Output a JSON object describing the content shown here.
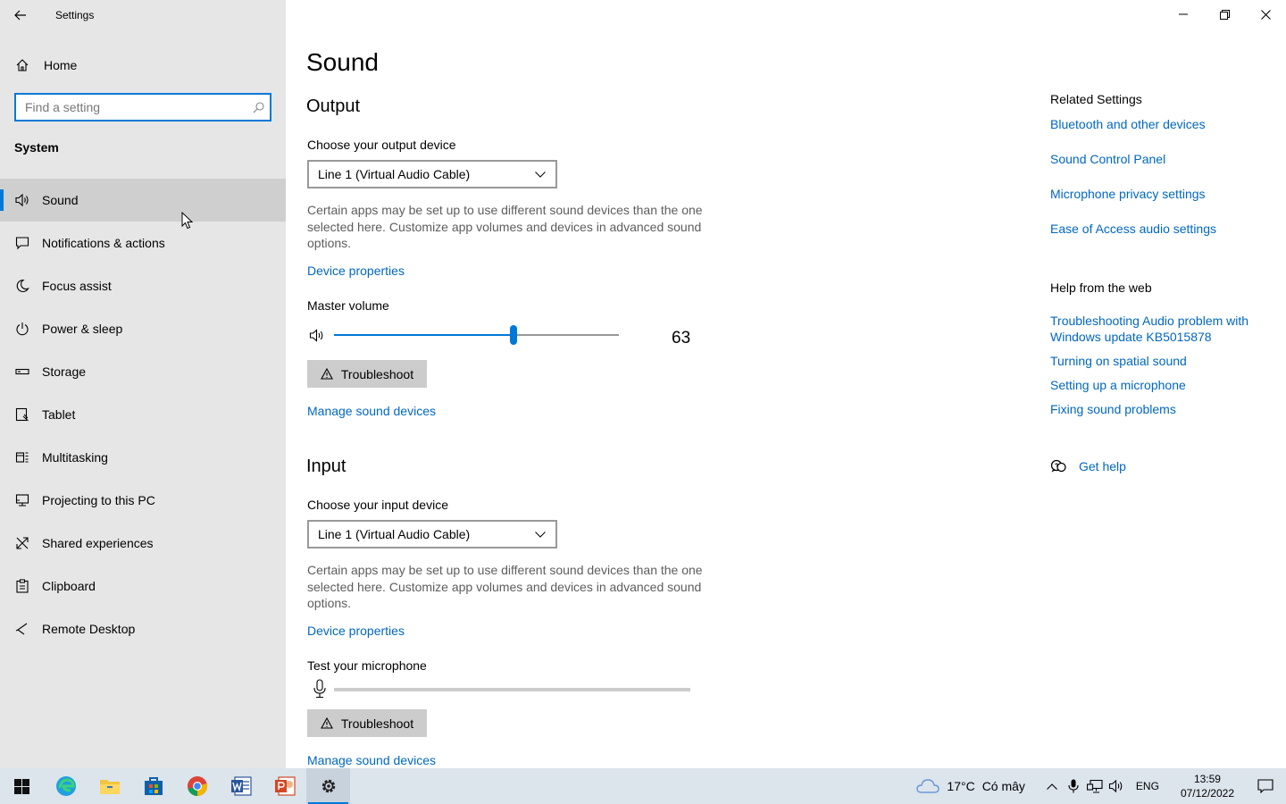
{
  "window": {
    "title": "Settings"
  },
  "sidebar": {
    "home_label": "Home",
    "search_placeholder": "Find a setting",
    "section": "System",
    "items": [
      {
        "label": "Sound",
        "icon": "speaker-icon",
        "active": true
      },
      {
        "label": "Notifications & actions",
        "icon": "message-icon"
      },
      {
        "label": "Focus assist",
        "icon": "moon-icon"
      },
      {
        "label": "Power & sleep",
        "icon": "power-icon"
      },
      {
        "label": "Storage",
        "icon": "storage-icon"
      },
      {
        "label": "Tablet",
        "icon": "tablet-icon"
      },
      {
        "label": "Multitasking",
        "icon": "multitasking-icon"
      },
      {
        "label": "Projecting to this PC",
        "icon": "projecting-icon"
      },
      {
        "label": "Shared experiences",
        "icon": "shared-icon"
      },
      {
        "label": "Clipboard",
        "icon": "clipboard-icon"
      },
      {
        "label": "Remote Desktop",
        "icon": "remote-icon"
      }
    ]
  },
  "main": {
    "title": "Sound",
    "output": {
      "heading": "Output",
      "choose_label": "Choose your output device",
      "device": "Line 1 (Virtual Audio Cable)",
      "description": "Certain apps may be set up to use different sound devices than the one selected here. Customize app volumes and devices in advanced sound options.",
      "device_properties": "Device properties",
      "master_volume_label": "Master volume",
      "volume": 63,
      "volume_text": "63",
      "troubleshoot": "Troubleshoot",
      "manage": "Manage sound devices"
    },
    "input": {
      "heading": "Input",
      "choose_label": "Choose your input device",
      "device": "Line 1 (Virtual Audio Cable)",
      "description": "Certain apps may be set up to use different sound devices than the one selected here. Customize app volumes and devices in advanced sound options.",
      "device_properties": "Device properties",
      "test_label": "Test your microphone",
      "troubleshoot": "Troubleshoot",
      "manage": "Manage sound devices"
    }
  },
  "related": {
    "heading": "Related Settings",
    "links": [
      "Bluetooth and other devices",
      "Sound Control Panel",
      "Microphone privacy settings",
      "Ease of Access audio settings"
    ],
    "help_heading": "Help from the web",
    "help_links": [
      "Troubleshooting Audio problem with Windows update KB5015878",
      "Turning on spatial sound",
      "Setting up a microphone",
      "Fixing sound problems"
    ],
    "get_help": "Get help"
  },
  "taskbar": {
    "weather_temp": "17°C",
    "weather_text": "Có mây",
    "language": "ENG",
    "time": "13:59",
    "date": "07/12/2022",
    "accent": "#0078d7"
  }
}
